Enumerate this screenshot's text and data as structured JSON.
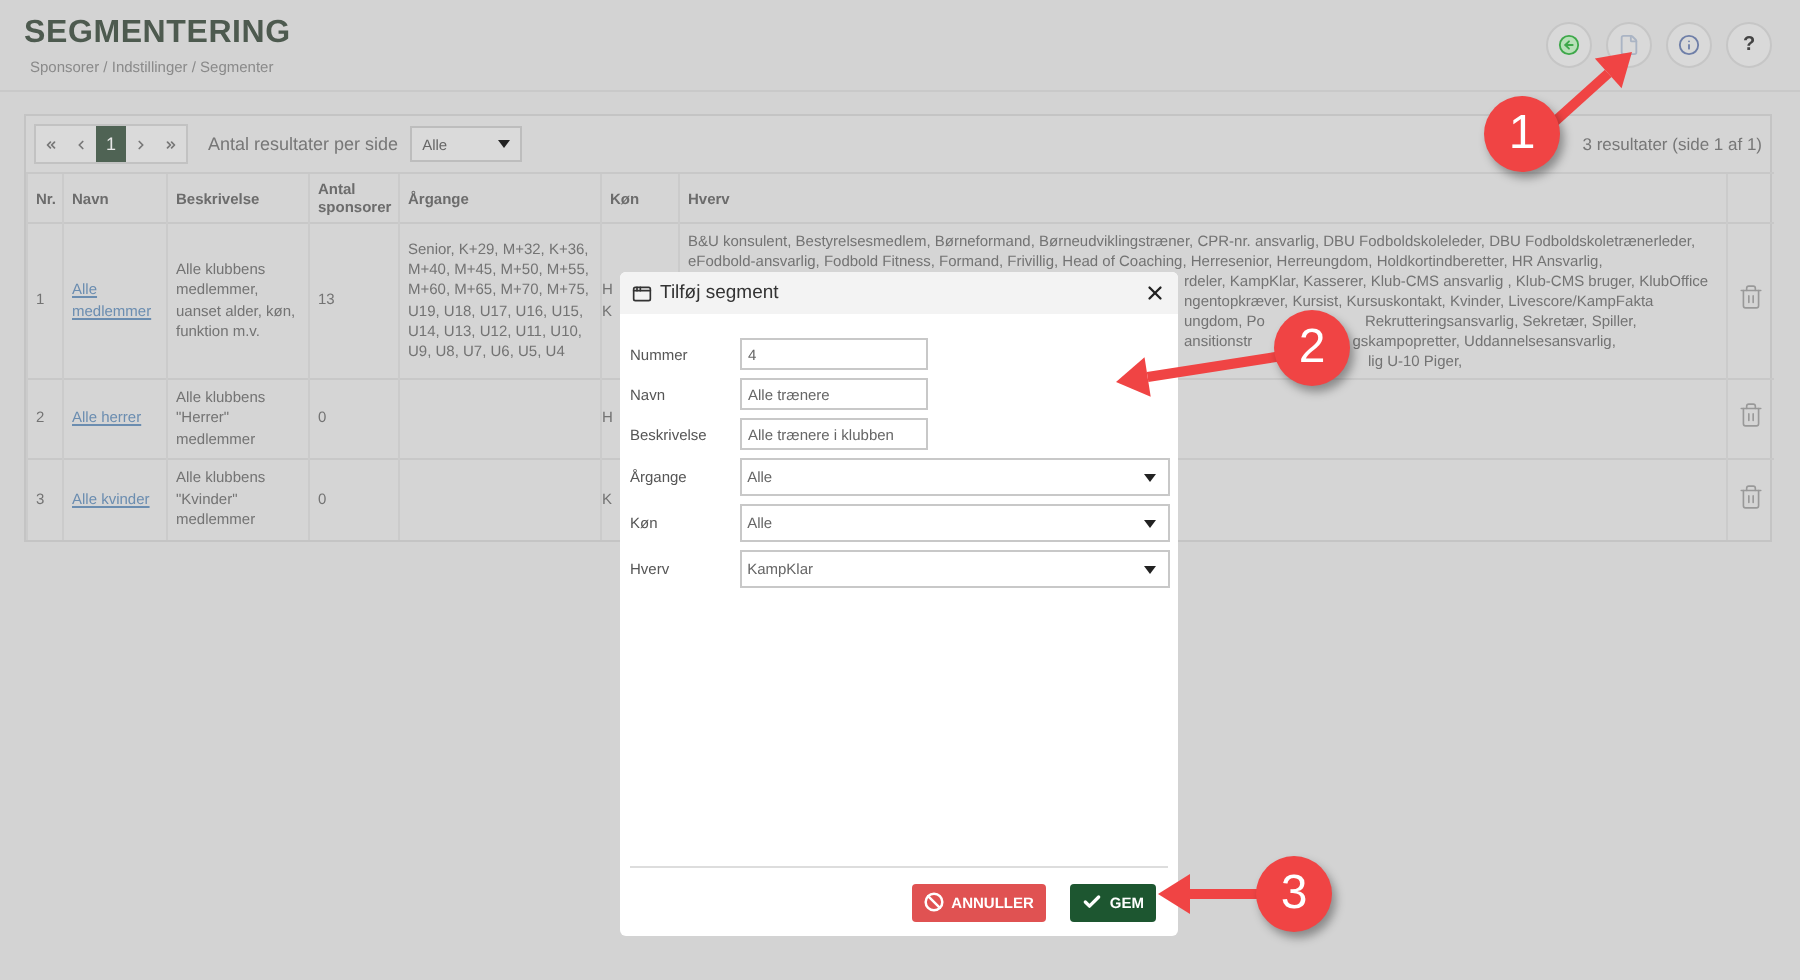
{
  "page": {
    "title": "SEGMENTERING",
    "breadcrumb": "Sponsorer / Indstillinger / Segmenter"
  },
  "toolbar": [
    {
      "kind": "back"
    },
    {
      "kind": "document"
    },
    {
      "kind": "info"
    },
    {
      "kind": "text",
      "label": "?"
    }
  ],
  "pager": {
    "pages": [
      {
        "label": "1",
        "selected": true
      }
    ],
    "per_page_label": "Antal resultater per side",
    "per_page": "Alle",
    "summary": "3 resultater (side 1 af 1)"
  },
  "table": {
    "columns": [
      "Nr.",
      "Navn",
      "Beskrivelse",
      "Antal sponsorer",
      "Årgange",
      "Køn",
      "Hverv"
    ],
    "rows": [
      {
        "nr": "1",
        "name": "Alle medlemmer",
        "description": "Alle klubbens medlemmer, uanset alder, køn, funktion m.v.",
        "sponsors": "13",
        "years": "Senior, K+29, M+32, K+36, M+40, M+45, M+50, M+55, M+60, M+65, M+70, M+75, U19, U18, U17, U16, U15, U14, U13, U12, U11, U10, U9, U8, U7, U6, U5, U4",
        "gender": [
          "H",
          "K"
        ],
        "roles": [
          {
            "kind": "full",
            "parts": [
              "B&U konsulent, Bestyrelsesmedlem, Børneformand, Børneudviklingstræner, CPR-nr. ansvarlig, DBU Fodboldskoleleder, DBU Fodboldskoletrænerleder,"
            ]
          },
          {
            "kind": "full",
            "parts": [
              "eFodbold-ansvarlig, Fodbold Fitness, Formand, Frivillig, Head of Coaching, Herresenior, Herreungdom, Holdkortindberetter, HR Ansvarlig,"
            ]
          },
          {
            "kind": "cut",
            "parts": [
              "rdeler, KampKlar, Kasserer, Klub-CMS ansvarlig , Klub-CMS bruger, KlubOffice"
            ]
          },
          {
            "kind": "cut",
            "parts": [
              "ngentopkræver, Kursist, Kursuskontakt, Kvinder, Livescore/KampFakta"
            ]
          },
          {
            "kind": "cut",
            "parts": [
              "ungdom, Po",
              "Rekrutteringsansvarlig, Sekretær, Spiller,"
            ]
          },
          {
            "kind": "cut",
            "parts": [
              "ansitionstr",
              "gskampopretter, Uddannelsesansvarlig,"
            ]
          },
          {
            "kind": "tail",
            "parts": [
              "lig U-10 Piger,"
            ]
          }
        ]
      },
      {
        "nr": "2",
        "name": "Alle herrer",
        "description": "Alle klubbens \"Herrer\" medlemmer",
        "sponsors": "0",
        "gender": [
          "H"
        ]
      },
      {
        "nr": "3",
        "name": "Alle kvinder",
        "description": "Alle klubbens \"Kvinder\" medlemmer",
        "sponsors": "0",
        "gender": [
          "K"
        ]
      }
    ]
  },
  "dialog": {
    "title": "Tilføj segment",
    "fields": [
      {
        "kind": "input",
        "label": "Nummer",
        "value": "4"
      },
      {
        "kind": "input",
        "label": "Navn",
        "value": "Alle trænere"
      },
      {
        "kind": "input",
        "label": "Beskrivelse",
        "value": "Alle trænere i klubben"
      },
      {
        "kind": "select",
        "label": "Årgange",
        "value": "Alle"
      },
      {
        "kind": "select",
        "label": "Køn",
        "value": "Alle"
      },
      {
        "kind": "select",
        "label": "Hverv",
        "value": "KampKlar"
      }
    ],
    "buttons": [
      {
        "kind": "cancel",
        "label": "ANNULLER"
      },
      {
        "kind": "save",
        "label": "GEM"
      }
    ]
  },
  "callouts": [
    {
      "label": "1"
    },
    {
      "label": "2"
    },
    {
      "label": "3"
    }
  ]
}
